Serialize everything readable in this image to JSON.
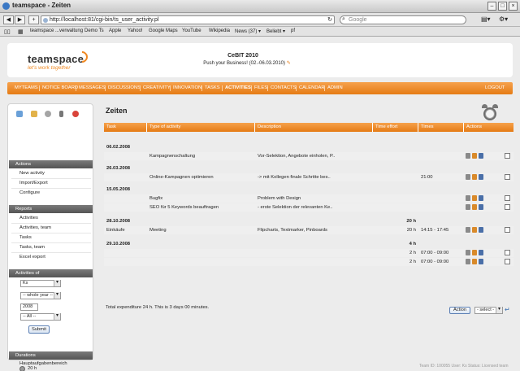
{
  "window": {
    "title": "teamspace - Zeiten"
  },
  "browser": {
    "url": "http://localhost:81/cgi-bin/ts_user_activity.pl",
    "search_placeholder": "Google",
    "bookmarks": [
      "teamspace ...verwaltung",
      "Demo Ts",
      "Apple",
      "Yahoo!",
      "Google Maps",
      "YouTube",
      "Wikipedia",
      "News (37) ▾",
      "Beliebt ▾",
      "pf"
    ]
  },
  "header": {
    "logo": "teamspace",
    "tagline": "let's work together",
    "event_title": "CeBIT 2010",
    "event_subtitle": "Push your Business! (02.-06.03.2010)"
  },
  "menu": {
    "items": [
      "MYTEAMS",
      "NOTICE BOARD",
      "MESSAGES",
      "DISCUSSIONS",
      "CREATIVITY",
      "INNOVATION",
      "TASKS",
      "ACTIVITIES",
      "FILES",
      "CONTACTS",
      "CALENDAR",
      "ADMIN"
    ],
    "active": "ACTIVITIES",
    "logout": "LOGOUT"
  },
  "sidebar": {
    "actions_heading": "Actions",
    "actions": [
      "New activity",
      "Import/Export",
      "Configure"
    ],
    "reports_heading": "Reports",
    "reports": [
      "Activities",
      "Activities, team",
      "Tasks",
      "Tasks, team",
      "Excel export"
    ],
    "activities_of_heading": "Activities of",
    "user_select": "Ks",
    "period_select": "-- whole year --",
    "year_value": "2008",
    "filter_select": "-- All --",
    "submit_label": "Submit",
    "durations_heading": "Durations",
    "durations_item": "Hauptaufgabenbereich",
    "durations_value": "20 h"
  },
  "main": {
    "title": "Zeiten",
    "columns": [
      "Task",
      "Type of activity",
      "Description",
      "Time effort",
      "Times",
      "Actions"
    ],
    "rows": [
      {
        "kind": "date",
        "task": "06.02.2008",
        "type": "",
        "desc": "",
        "effort": "",
        "times": ""
      },
      {
        "kind": "entry",
        "task": "",
        "type": "Kampagnenschaltung",
        "desc": "Vor-Selektion, Angebote einholen, P..",
        "effort": "",
        "times": ""
      },
      {
        "kind": "date",
        "task": "26.03.2008",
        "type": "",
        "desc": "",
        "effort": "",
        "times": ""
      },
      {
        "kind": "entry",
        "task": "",
        "type": "Online-Kampagnen optimieren",
        "desc": "-> mit Kollegen finale Schritte bes..",
        "effort": "",
        "times": "21:00"
      },
      {
        "kind": "date",
        "task": "15.05.2008",
        "type": "",
        "desc": "",
        "effort": "",
        "times": ""
      },
      {
        "kind": "entry",
        "task": "",
        "type": "Bugfix",
        "desc": "Problem with Design",
        "effort": "",
        "times": ""
      },
      {
        "kind": "entry",
        "task": "",
        "type": "SEO für 5 Keywords beauftragen",
        "desc": "- erste Selektion der relevanten Ke..",
        "effort": "",
        "times": ""
      },
      {
        "kind": "date",
        "task": "28.10.2008",
        "type": "",
        "desc": "",
        "effort": "20 h",
        "times": ""
      },
      {
        "kind": "entry",
        "task": "Einkäufe",
        "type": "Meeting",
        "desc": "Flipcharts, Textmarker, Pinboards",
        "effort": "20 h",
        "times": "14:15 - 17:45"
      },
      {
        "kind": "date",
        "task": "29.10.2008",
        "type": "",
        "desc": "",
        "effort": "4 h",
        "times": ""
      },
      {
        "kind": "entry",
        "task": "",
        "type": "",
        "desc": "",
        "effort": "2 h",
        "times": "07:00 - 09:00"
      },
      {
        "kind": "entry",
        "task": "",
        "type": "",
        "desc": "",
        "effort": "2 h",
        "times": "07:00 - 09:00"
      }
    ],
    "total": "Total expenditure 24 h. This is  3 days 00 minutes.",
    "action_button": "Action",
    "action_select": "- select -"
  },
  "footer": "Team ID: 100055  User: Ks  Status: Licensed team"
}
